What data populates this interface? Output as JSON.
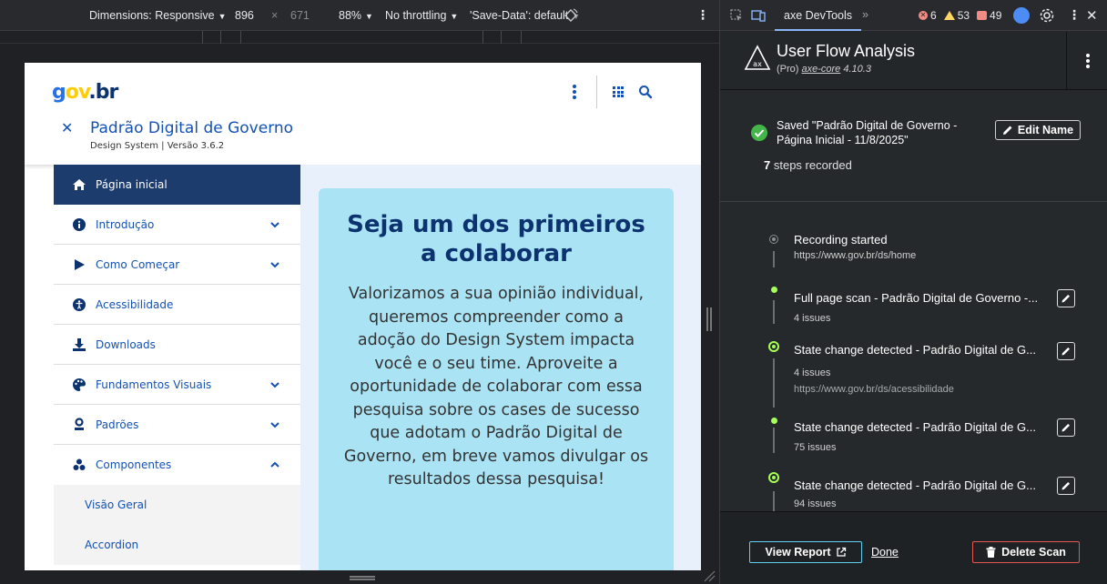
{
  "device_toolbar": {
    "dimensions_label": "Dimensions: Responsive",
    "width": "896",
    "times": "×",
    "height": "671",
    "zoom": "88%",
    "throttling": "No throttling",
    "save_data": "'Save-Data': default"
  },
  "page": {
    "logo": {
      "g": "g",
      "o": "ov",
      "br": ".br"
    },
    "site_title": "Padrão Digital de Governo",
    "site_subtitle": "Design System | Versão 3.6.2",
    "nav": [
      {
        "label": "Página inicial"
      },
      {
        "label": "Introdução"
      },
      {
        "label": "Como Começar"
      },
      {
        "label": "Acessibilidade"
      },
      {
        "label": "Downloads"
      },
      {
        "label": "Fundamentos Visuais"
      },
      {
        "label": "Padrões"
      },
      {
        "label": "Componentes"
      }
    ],
    "subnav": [
      {
        "label": "Visão Geral"
      },
      {
        "label": "Accordion"
      }
    ],
    "hero": {
      "title": "Seja um dos primeiros a colaborar",
      "body": "Valorizamos a sua opinião individual, queremos compreender como a adoção do Design System impacta você e o seu time. Aproveite a oportunidade de colaborar com essa pesquisa sobre os cases de sucesso que adotam o Padrão Digital de Governo, em breve vamos divulgar os resultados dessa pesquisa!"
    }
  },
  "devtools": {
    "tab_label": "axe DevTools",
    "more": "»",
    "errors": "6",
    "warnings": "53",
    "issues": "49"
  },
  "axe": {
    "title": "User Flow Analysis",
    "sub_prefix": "(Pro) ",
    "sub_link": "axe-core",
    "sub_version": " 4.10.3",
    "saved_text": "Saved \"Padrão Digital de Governo - Página Inicial - 11/8/2025\"",
    "edit_name": "Edit Name",
    "steps_count": "7",
    "steps_suffix": " steps recorded",
    "steps": [
      {
        "title": "Recording started",
        "meta": "https://www.gov.br/ds/home"
      },
      {
        "title": "Full page scan - Padrão Digital de Governo -...",
        "meta": "4 issues"
      },
      {
        "title": "State change detected - Padrão Digital de G...",
        "meta": "4 issues",
        "url": "https://www.gov.br/ds/acessibilidade"
      },
      {
        "title": "State change detected - Padrão Digital de G...",
        "meta": "75 issues"
      },
      {
        "title": "State change detected - Padrão Digital de G...",
        "meta": "94 issues"
      }
    ],
    "view_report": "View Report",
    "done": "Done",
    "delete_scan": "Delete Scan"
  }
}
